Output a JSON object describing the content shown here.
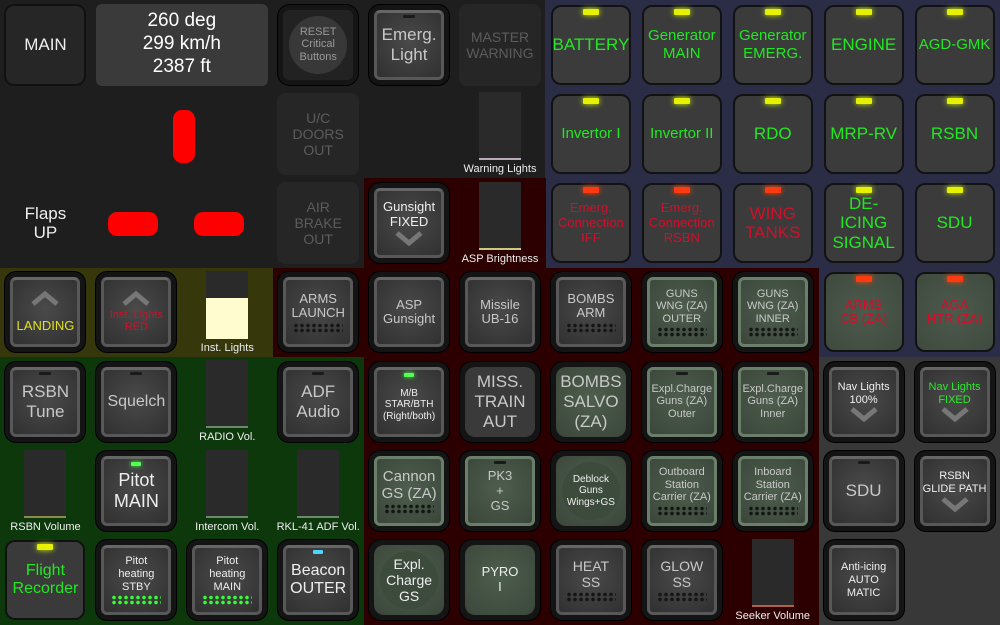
{
  "top": {
    "main": "MAIN",
    "heading": "260 deg",
    "speed": "299 km/h",
    "altitude": "2387 ft",
    "reset": "RESET\nCritical\nButtons",
    "emerg_light": "Emerg.\nLight",
    "master_warning": "MASTER\nWARNING",
    "uc_doors": "U/C\nDOORS\nOUT",
    "air_brake": "AIR\nBRAKE\nOUT",
    "flaps": "Flaps\nUP",
    "gunsight": "Gunsight\nFIXED"
  },
  "sliders": {
    "warning_lights": "Warning Lights",
    "asp_brightness": "ASP Brightness",
    "inst_lights": "Inst. Lights",
    "radio_vol": "RADIO Vol.",
    "rsbn_volume": "RSBN Volume",
    "intercom_vol": "Intercom Vol.",
    "adf_vol": "RKL-41 ADF Vol.",
    "seeker_volume": "Seeker Volume",
    "inst_lights_level": 0.6
  },
  "annunciators": {
    "battery": "BATTERY",
    "gen_main": "Generator\nMAIN",
    "gen_emerg": "Generator\nEMERG.",
    "engine": "ENGINE",
    "agd": "AGD-GMK",
    "inv1": "Invertor I",
    "inv2": "Invertor II",
    "rdo": "RDO",
    "mrp": "MRP-RV",
    "rsbn": "RSBN",
    "iff": "Emerg.\nConnection\nIFF",
    "emerg_rsbn": "Emerg.\nConnection\nRSBN",
    "wing_tanks": "WING\nTANKS",
    "deicing": "DE-ICING\nSIGNAL",
    "sdu": "SDU",
    "arms_cb": "ARMS\nCB (ZA)",
    "aga_htr": "AGA\nHTR (ZA)"
  },
  "buttons": {
    "landing": "LANDING",
    "inst_red": "Inst. Lights\nRED",
    "arms_launch": "ARMS\nLAUNCH",
    "asp_gunsight": "ASP\nGunsight",
    "missile": "Missile\nUB-16",
    "bombs_arm": "BOMBS\nARM",
    "guns_outer": "GUNS\nWNG (ZA)\nOUTER",
    "guns_inner": "GUNS\nWNG (ZA)\nINNER",
    "rsbn_tune": "RSBN\nTune",
    "squelch": "Squelch",
    "adf_audio": "ADF\nAudio",
    "mb_star": "M/B\nSTAR/BTH\n(Right/both)",
    "miss_train": "MISS.\nTRAIN\nAUT",
    "bombs_salvo": "BOMBS\nSALVO\n(ZA)",
    "expl_outer": "Expl.Charge\nGuns (ZA)\nOuter",
    "expl_inner": "Expl.Charge\nGuns (ZA)\nInner",
    "nav100": "Nav Lights\n100%",
    "nav_fixed": "Nav Lights\nFIXED",
    "pitot_main": "Pitot\nMAIN",
    "cannon": "Cannon\nGS (ZA)",
    "pk3": "PK3\n+\nGS",
    "deblock": "Deblock\nGuns\nWings+GS",
    "outboard": "Outboard\nStation\nCarrier (ZA)",
    "inboard": "Inboard\nStation\nCarrier (ZA)",
    "sdu2": "SDU",
    "glide": "RSBN\nGLIDE PATH",
    "flight_rec": "Flight\nRecorder",
    "pitot_stby": "Pitot\nheating\nSTBY",
    "pitot_heat_main": "Pitot\nheating\nMAIN",
    "beacon": "Beacon\nOUTER",
    "expl_gs": "Expl.\nCharge\nGS",
    "pyro": "PYRO\nI",
    "heat": "HEAT\nSS",
    "glow": "GLOW\nSS",
    "anti_icing": "Anti-icing\nAUTO\nMATIC"
  },
  "colors": {
    "lit_green": "#2ee82e",
    "warn_red": "#d0102a",
    "landing_yellow": "#e0e020"
  }
}
